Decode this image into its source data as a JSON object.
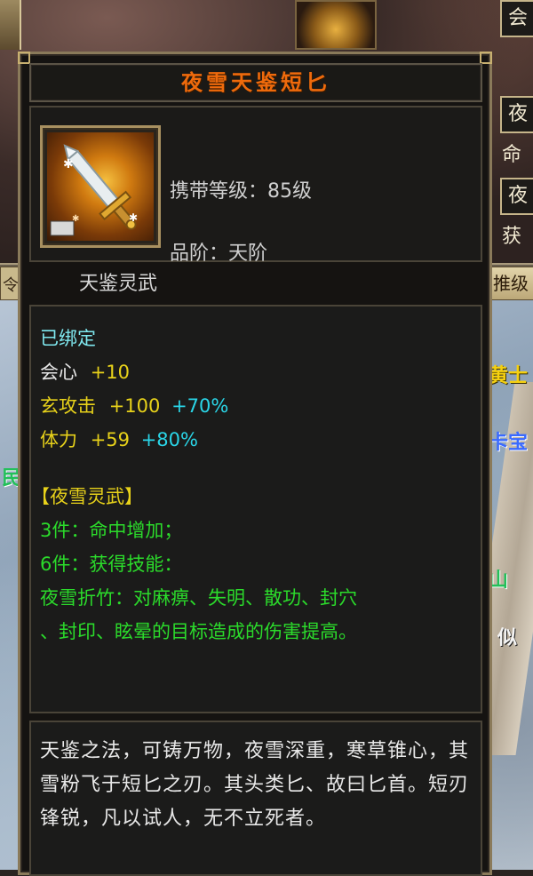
{
  "scene": {
    "side_buttons": [
      "会",
      "夜",
      "夜"
    ],
    "side_labels": [
      "命",
      "获"
    ],
    "tab_left": "令",
    "tab_right": "推级",
    "floating": [
      "黄士",
      "卡宝",
      "山",
      "似",
      "民"
    ]
  },
  "item": {
    "name": "夜雪天鉴短匕",
    "level_label": "携带等级：",
    "level_value": "85级",
    "grade_label": "品阶：",
    "grade_value": "天阶",
    "category": "天鉴灵武",
    "icon": "dagger-icon"
  },
  "attributes": {
    "bound": "已绑定",
    "stats": [
      {
        "name": "会心",
        "value": "+10",
        "bonus": ""
      },
      {
        "name": "玄攻击",
        "value": "+100",
        "bonus": "+70%"
      },
      {
        "name": "体力",
        "value": "+59",
        "bonus": "+80%"
      }
    ],
    "set_name": "【夜雪灵武】",
    "set_effects": [
      "3件：命中增加；",
      "6件：获得技能：",
      "夜雪折竹：对麻痹、失明、散功、封穴",
      "、封印、眩晕的目标造成的伤害提高。"
    ]
  },
  "description": "天鉴之法，可铸万物，夜雪深重，寒草锥心，其雪粉飞于短匕之刃。其头类匕、故曰匕首。短刃锋锐，凡以试人，无不立死者。",
  "colors": {
    "title": "#ee6a0c",
    "bound": "#7fe8ef",
    "stat_value": "#e8d21a",
    "stat_bonus": "#2ad6e8",
    "set_text": "#2bdb2b",
    "set_name": "#e8d21a"
  }
}
